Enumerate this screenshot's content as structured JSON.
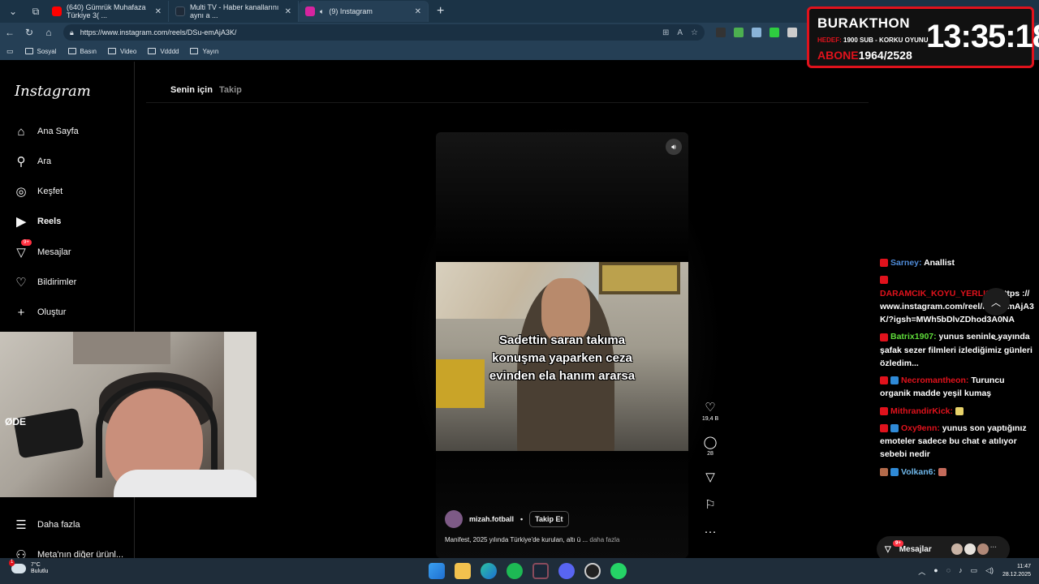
{
  "browser": {
    "tabs": [
      {
        "title": "(640) Gümrük Muhafaza Türkiye 3( ...",
        "active": false,
        "favicon_color": "#ff0000"
      },
      {
        "title": "Multi TV - Haber kanallarını aynı a ...",
        "active": false,
        "favicon_color": "#1e2a38"
      },
      {
        "title": "(9) Instagram",
        "active": true,
        "favicon_color": "#d6249f"
      }
    ],
    "url": "https://www.instagram.com/reels/DSu-emAjA3K/",
    "bookmarks": [
      "Sosyal",
      "Basın",
      "Video",
      "Vdddd",
      "Yayın"
    ]
  },
  "overlay": {
    "name": "BURAKTHON",
    "goal_label": "HEDEF:",
    "goal_text": "1900 SUB - KORKU OYUNU",
    "sub_label": "ABONE",
    "sub_count": "1964/2528",
    "timer": "13:35:18"
  },
  "instagram": {
    "logo": "Instagram",
    "nav": [
      {
        "label": "Ana Sayfa",
        "icon": "home-icon"
      },
      {
        "label": "Ara",
        "icon": "search-icon"
      },
      {
        "label": "Keşfet",
        "icon": "compass-icon"
      },
      {
        "label": "Reels",
        "icon": "reels-icon"
      },
      {
        "label": "Mesajlar",
        "icon": "messenger-icon",
        "badge": "9+"
      },
      {
        "label": "Bildirimler",
        "icon": "heart-icon"
      },
      {
        "label": "Oluştur",
        "icon": "plus-icon"
      }
    ],
    "more": "Daha fazla",
    "meta": "Meta'nın diğer ürünl...",
    "feed_tabs": {
      "active": "Senin için",
      "inactive": "Takip"
    },
    "reel": {
      "caption_overlay": [
        "Sadettin saran takıma",
        "konuşma yaparken ceza",
        "evinden ela hanım ararsa"
      ],
      "username": "mizah.fotball",
      "separator": "•",
      "follow": "Takip Et",
      "description": "Manifest, 2025 yılında Türkiye'de kurulan, altı ü ...",
      "more": "daha fazla",
      "likes": "19,4 B",
      "comments": "28"
    },
    "messages_pill": {
      "label": "Mesajlar",
      "badge": "9+"
    }
  },
  "chat": {
    "messages": [
      {
        "user": "Sarney:",
        "text": "Anallist"
      },
      {
        "user": "DARAMCIK_KOYU_YERLISI:",
        "text": "https ://www.instagram.com/reel/DSu-emAjA3K/?igsh=MWh5bDlvZDhod3A0NA"
      },
      {
        "user": "Batrix1907:",
        "text": "yunus seninle yayında şafak sezer filmleri izlediğimiz günleri özledim..."
      },
      {
        "user": "Necromantheon:",
        "text": "Turuncu organik madde yeşil kumaş"
      },
      {
        "user": "MithrandirKick:",
        "text": ""
      },
      {
        "user": "Oxy9enn:",
        "text": "yunus son yaptığınız emoteler sadece bu chat e atılıyor sebebi nedir"
      },
      {
        "user": "Volkan6:",
        "text": ""
      }
    ]
  },
  "taskbar": {
    "weather_temp": "7°C",
    "weather_desc": "Bulutlu",
    "weather_badge": "1",
    "time": "11:47",
    "date": "28.12.2025"
  },
  "webcam": {
    "mic_brand": "ØDE"
  }
}
